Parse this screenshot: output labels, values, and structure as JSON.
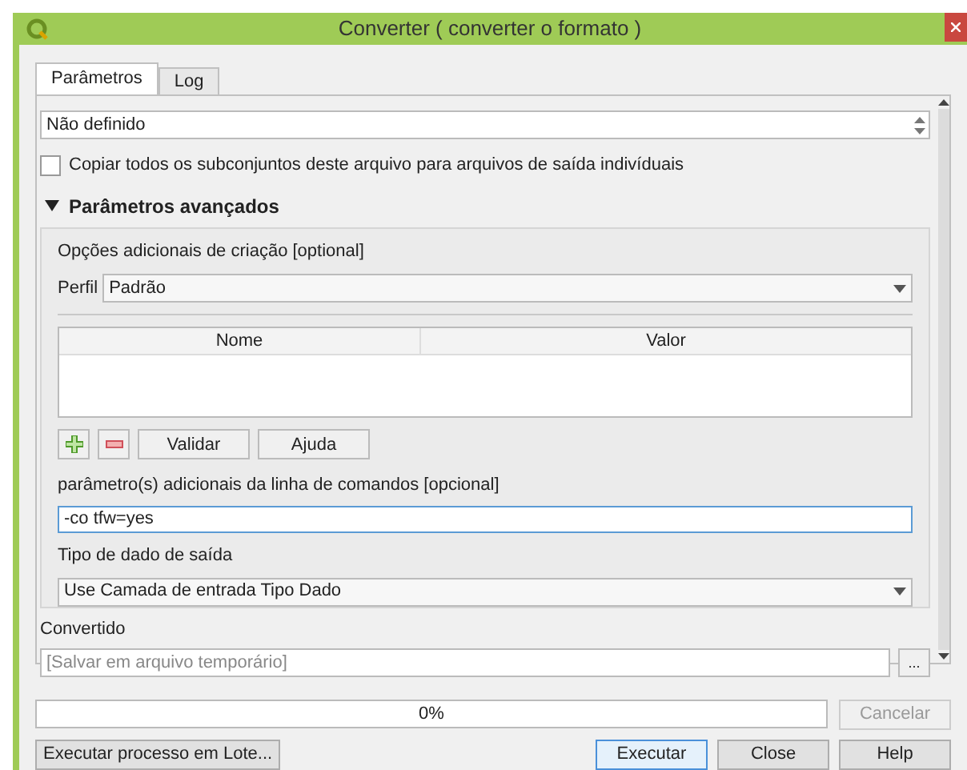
{
  "window": {
    "title": "Converter ( converter o formato )"
  },
  "tabs": [
    {
      "label": "Parâmetros",
      "selected": true
    },
    {
      "label": "Log",
      "selected": false
    }
  ],
  "format_field": {
    "value": "Não definido"
  },
  "copy_subsets": {
    "label": "Copiar todos os subconjuntos deste arquivo para arquivos de saída indivíduais",
    "checked": false
  },
  "advanced": {
    "label": "Parâmetros avançados",
    "expanded": true,
    "creation_options_label": "Opções adicionais de criação [optional]",
    "profile_label": "Perfil",
    "profile_value": "Padrão",
    "table": {
      "columns": [
        "Nome",
        "Valor"
      ]
    },
    "buttons": [
      "Validar",
      "Ajuda"
    ],
    "extra_params_label": "parâmetro(s) adicionais da linha de comandos [opcional]",
    "extra_params_value": "-co tfw=yes",
    "data_type_label": "Tipo de dado de saída",
    "data_type_value": "Use Camada de entrada Tipo Dado"
  },
  "output": {
    "label": "Convertido",
    "placeholder": "[Salvar em arquivo temporário]",
    "browse": "..."
  },
  "progress": {
    "reading": "0%",
    "level": 0
  },
  "cancel": {
    "label": "Cancelar",
    "disabled": true
  },
  "footer_buttons": [
    {
      "label": "Executar processo em Lote...",
      "kind": "left"
    },
    {
      "label": "Executar",
      "kind": "default"
    },
    {
      "label": "Close",
      "kind": "normal"
    },
    {
      "label": "Help",
      "kind": "normal"
    }
  ]
}
